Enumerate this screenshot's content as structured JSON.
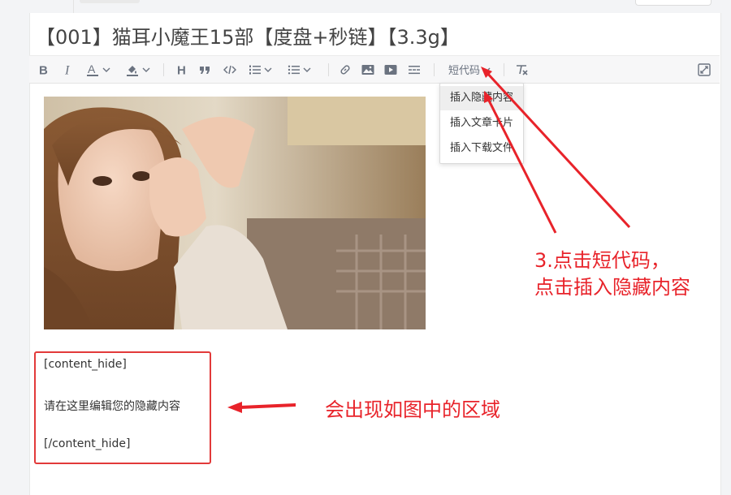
{
  "post": {
    "title": "【001】猫耳小魔王15部【度盘+秒链】【3.3g】"
  },
  "toolbar": {
    "items": [
      {
        "name": "bold",
        "icon": "bold-icon"
      },
      {
        "name": "italic",
        "icon": "italic-icon"
      },
      {
        "name": "text-color",
        "icon": "text-color-icon"
      },
      {
        "name": "highlight",
        "icon": "highlight-icon"
      },
      {
        "name": "heading",
        "icon": "heading-icon"
      },
      {
        "name": "quote",
        "icon": "quote-icon"
      },
      {
        "name": "code",
        "icon": "code-icon"
      },
      {
        "name": "ordered-list",
        "icon": "ordered-list-icon"
      },
      {
        "name": "bullet-list",
        "icon": "bullet-list-icon"
      },
      {
        "name": "link",
        "icon": "link-icon"
      },
      {
        "name": "image",
        "icon": "image-icon"
      },
      {
        "name": "video",
        "icon": "video-icon"
      },
      {
        "name": "horizontal-rule",
        "icon": "horizontal-rule-icon"
      },
      {
        "name": "clear-format",
        "icon": "clear-format-icon"
      },
      {
        "name": "fullscreen",
        "icon": "fullscreen-icon"
      }
    ],
    "shortcode_label": "短代码"
  },
  "shortcode_menu": {
    "items": [
      {
        "label": "插入隐藏内容",
        "active": true
      },
      {
        "label": "插入文章卡片",
        "active": false
      },
      {
        "label": "插入下载文件",
        "active": false
      }
    ]
  },
  "editor": {
    "image_alt": "girl-photo",
    "hide_block": {
      "open_tag": "[content_hide]",
      "body": "请在这里编辑您的隐藏内容",
      "close_tag": "[/content_hide]"
    }
  },
  "annotations": {
    "step_line1": "3.点击短代码，",
    "step_line2": "点击插入隐藏内容",
    "area_note": "会出现如图中的区域"
  },
  "colors": {
    "annotation_red": "#e8232a",
    "toolbar_icon": "#6b7380",
    "toolbar_bg": "#f7f7f8"
  }
}
